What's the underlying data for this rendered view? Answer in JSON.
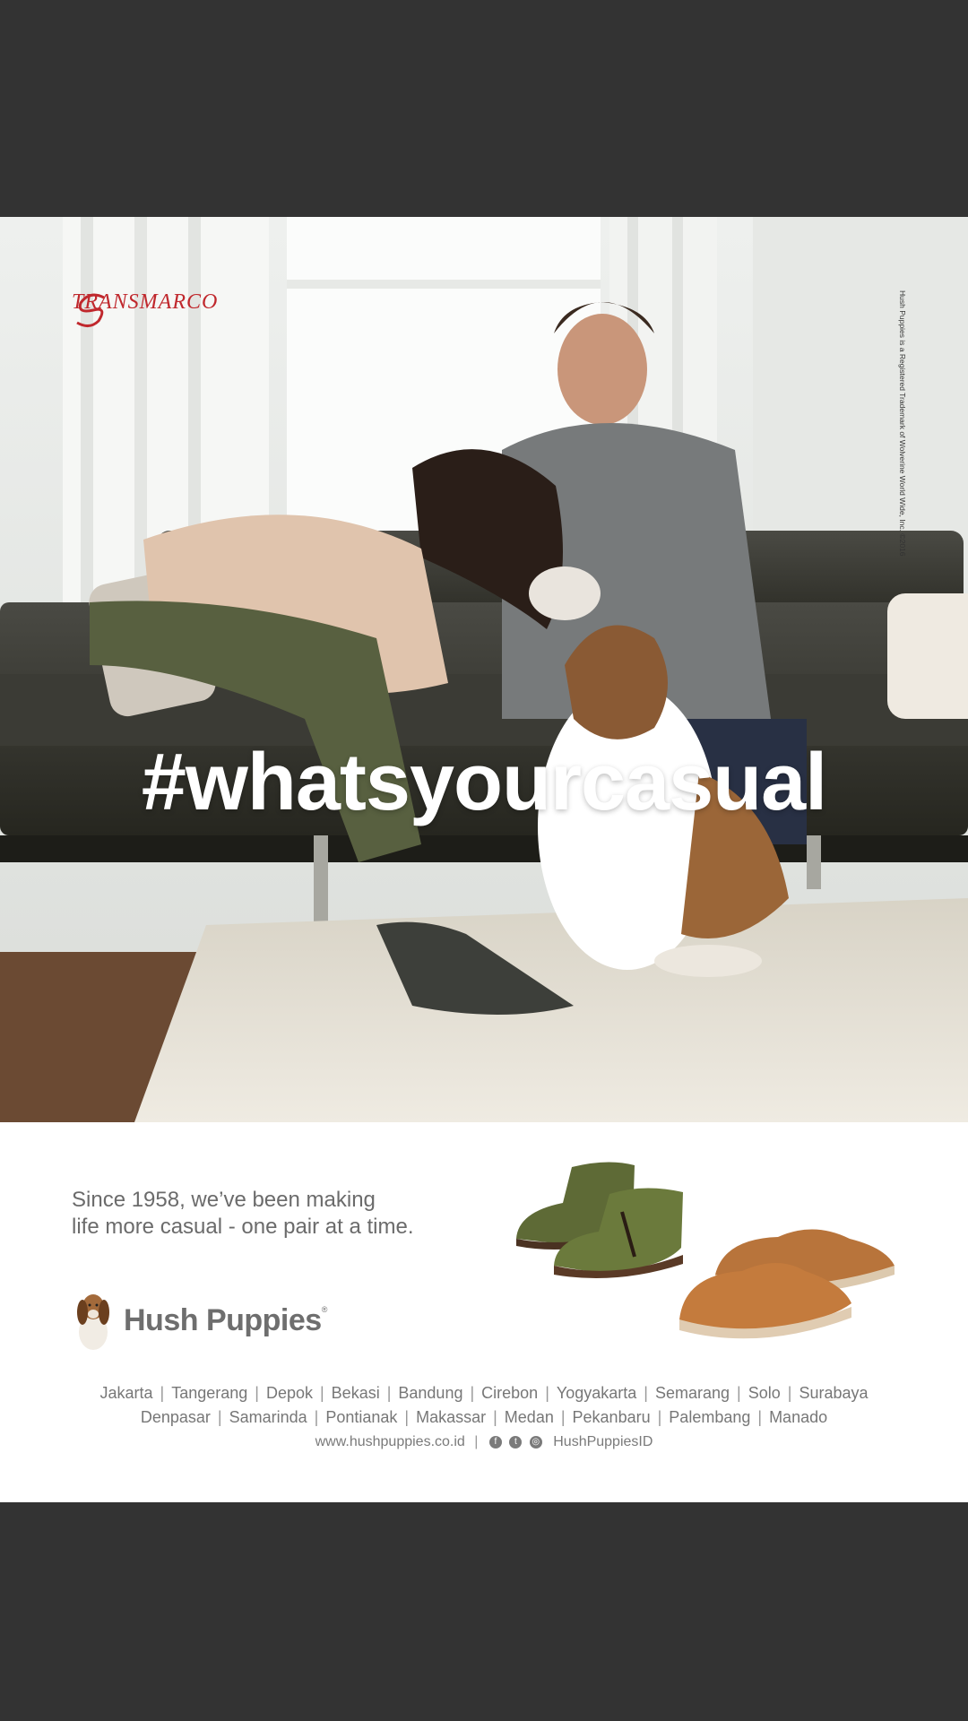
{
  "ad": {
    "brand_partner": "TRANSMARCO",
    "hashtag": "#whatsyourcasual",
    "trademark_notice": "Hush Puppies is a Registered Trademark of Wolverine World Wide, Inc. ©2016",
    "tagline_line1": "Since 1958, we’ve been making",
    "tagline_line2": "life more casual - one pair at a time.",
    "brand_name": "Hush Puppies",
    "brand_reg": "®",
    "cities_row1": [
      "Jakarta",
      "Tangerang",
      "Depok",
      "Bekasi",
      "Bandung",
      "Cirebon",
      "Yogyakarta",
      "Semarang",
      "Solo",
      "Surabaya"
    ],
    "cities_row2": [
      "Denpasar",
      "Samarinda",
      "Pontianak",
      "Makassar",
      "Medan",
      "Pekanbaru",
      "Palembang",
      "Manado"
    ],
    "website": "www.hushpuppies.co.id",
    "social_handle": "HushPuppiesID",
    "social_icons": [
      "facebook-icon",
      "twitter-icon",
      "instagram-icon"
    ]
  },
  "colors": {
    "frame": "#333333",
    "transmarco_red": "#c0282d",
    "text_gray": "#6b6b6b"
  }
}
